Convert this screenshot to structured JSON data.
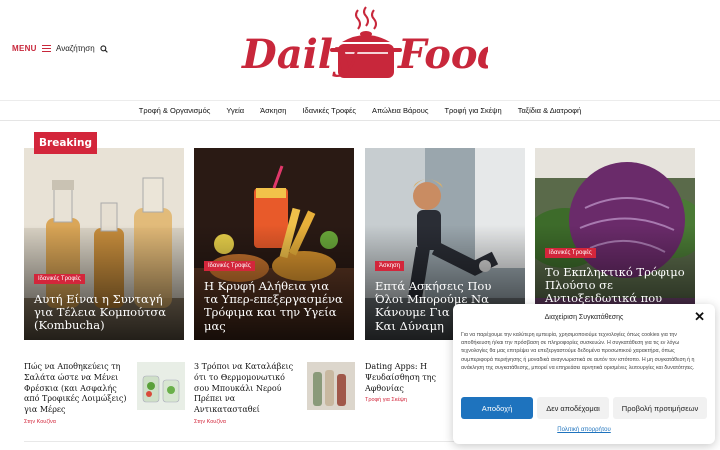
{
  "header": {
    "menu_label": "MENU",
    "search_label": "Αναζήτηση",
    "logo_word1": "Daily",
    "logo_word2": "Food"
  },
  "nav": [
    "Τροφή & Οργανισμός",
    "Υγεία",
    "Άσκηση",
    "Ιδανικές Τροφές",
    "Απώλεια Βάρους",
    "Τροφή για Σκέψη",
    "Ταξίδια & Διατροφή"
  ],
  "breaking_label": "Breaking",
  "cards": [
    {
      "tag": "Ιδανικές Τροφές",
      "title": "Αυτή Είναι η Συνταγή για Τέλεια Κομπούτσα (Kombucha)"
    },
    {
      "tag": "Ιδανικές Τροφές",
      "title": "Η Κρυφή Αλήθεια για τα Υπερ-επεξεργασμένα Τρόφιμα και την Υγεία μας"
    },
    {
      "tag": "Άσκηση",
      "title": "Επτά Ασκήσεις Που Όλοι Μπορούμε Να Κάνουμε Για Ισορροπία Και Δύναμη"
    },
    {
      "tag": "Ιδανικές Τροφές",
      "title": "Το Εκπληκτικό Τρόφιμο Πλούσιο σε Αντιοξειδωτικά που"
    }
  ],
  "list_items": [
    {
      "title": "Πώς να Αποθηκεύεις τη Σαλάτα ώστε να Μένει Φρέσκια (και Ασφαλής από Τροφικές Λοιμώξεις) για Μέρες",
      "category": "Στην Κουζίνα"
    },
    {
      "title": "3 Τρόποι να Καταλάβεις ότι το Θερμομονωτικό σου Μπουκάλι Νερού Πρέπει να Αντικατασταθεί",
      "category": "Στην Κουζίνα"
    },
    {
      "title": "Dating Apps: Η Ψευδαίσθηση της Αφθονίας",
      "category": "Τροφή για Σκέψη"
    }
  ],
  "consent": {
    "title": "Διαχείριση Συγκατάθεσης",
    "text": "Για να παρέχουμε την καλύτερη εμπειρία, χρησιμοποιούμε τεχνολογίες όπως cookies για την αποθήκευση ή/και την πρόσβαση σε πληροφορίες συσκευών. Η συγκατάθεση για τις εν λόγω τεχνολογίες θα μας επιτρέψει να επεξεργαστούμε δεδομένα προσωπικού χαρακτήρα, όπως συμπεριφορά περιήγησης ή μοναδικά αναγνωριστικά σε αυτόν τον ιστότοπο. Η μη συγκατάθεση ή η ανάκληση της συγκατάθεσης, μπορεί να επηρεάσει αρνητικά ορισμένες λειτουργίες και δυνατότητες.",
    "accept": "Αποδοχή",
    "deny": "Δεν αποδέχομαι",
    "preferences": "Προβολή προτιμήσεων",
    "policy": "Πολιτική απορρήτου"
  },
  "colors": {
    "brand": "#c8273b",
    "accent_blue": "#1e73be"
  }
}
